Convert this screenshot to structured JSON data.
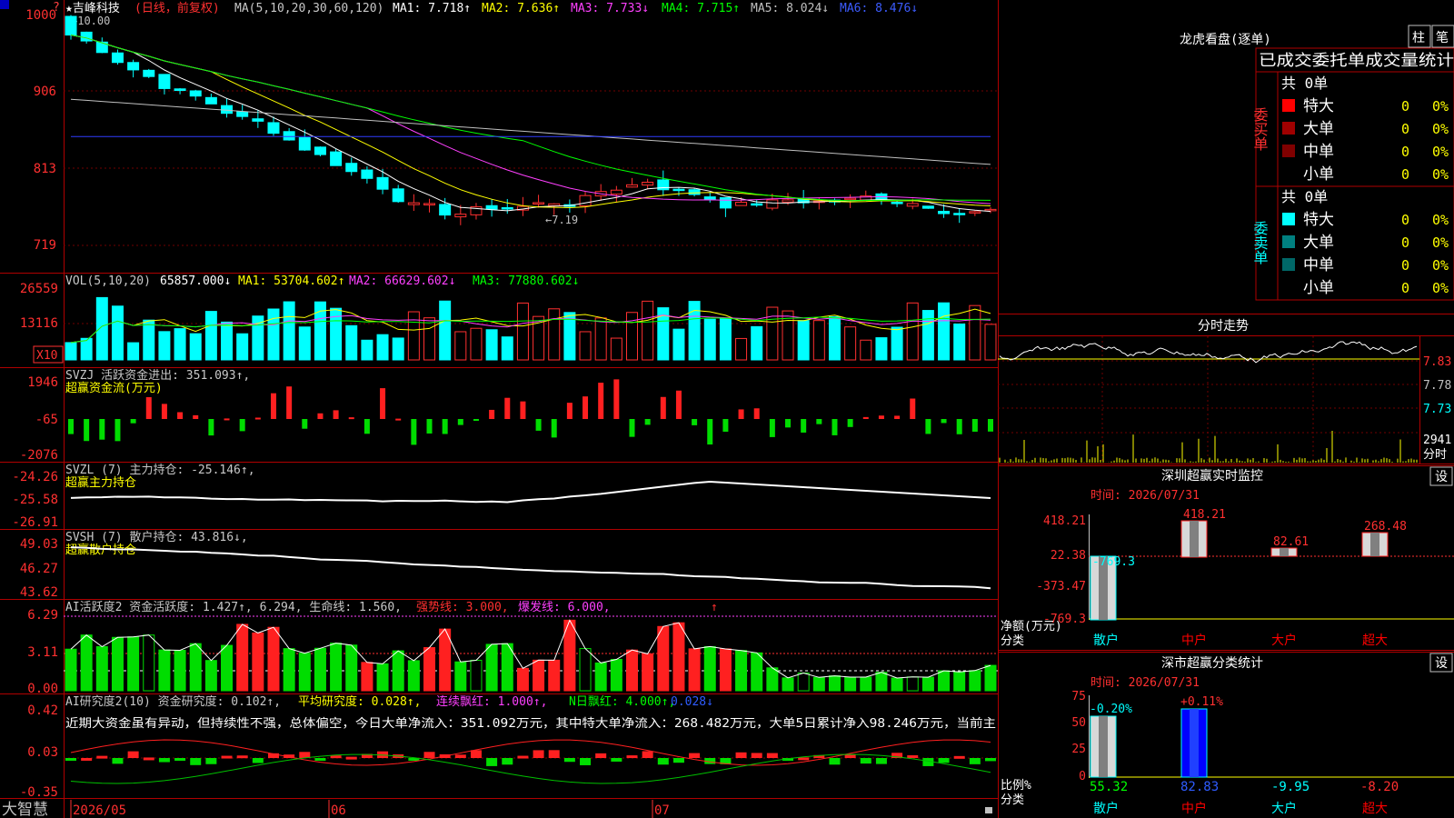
{
  "header": {
    "stock_label": "★吉峰科技",
    "period_label": "(日线，前复权)",
    "ma_label": "MA(5,10,20,30,60,120)",
    "ma_values": [
      {
        "text": "MA1: 7.718↑",
        "color": "#ffffff"
      },
      {
        "text": "MA2: 7.636↑",
        "color": "#ffff00"
      },
      {
        "text": "MA3: 7.733↓",
        "color": "#ff40ff"
      },
      {
        "text": "MA4: 7.715↑",
        "color": "#00ff00"
      },
      {
        "text": "MA5: 8.024↓",
        "color": "#c0c0c0"
      },
      {
        "text": "MA6: 8.476↓",
        "color": "#2f3cff"
      }
    ],
    "corner_mark": "?"
  },
  "price_panel": {
    "y_ticks": [
      "1000",
      "906",
      "813",
      "719"
    ],
    "high_label": "10.00",
    "low_label": "7.19"
  },
  "volume_panel": {
    "label": "VOL(5,10,20)",
    "value": "65857.000↓",
    "ma_values": [
      {
        "text": "MA1: 53704.602↑",
        "color": "#ffff00"
      },
      {
        "text": "MA2: 66629.602↓",
        "color": "#ff40ff"
      },
      {
        "text": "MA3: 77880.602↓",
        "color": "#00ff00"
      }
    ],
    "y_ticks": [
      "26559",
      "13116"
    ],
    "unit_box": "X10"
  },
  "svzj_panel": {
    "label": "SVZJ  活跃资金进出: 351.093↑,",
    "sublabel": "超赢资金流(万元)",
    "y_ticks": [
      "1946",
      "-65",
      "-2076"
    ]
  },
  "svzl_panel": {
    "label": "SVZL (7) 主力持仓: -25.146↑,",
    "sublabel": "超赢主力持仓",
    "y_ticks": [
      "-24.26",
      "-25.58",
      "-26.91"
    ]
  },
  "svsh_panel": {
    "label": "SVSH (7) 散户持仓: 43.816↓,",
    "sublabel": "超赢散户持仓",
    "y_ticks": [
      "49.03",
      "46.27",
      "43.62"
    ]
  },
  "ai_activity_panel": {
    "label": "AI活跃度2 资金活跃度: 1.427↑, 6.294, 生命线: 1.560,",
    "strong_line": "强势线: 3.000,",
    "burst_line": "爆发线: 6.000,",
    "y_ticks": [
      "6.29",
      "3.11",
      "0.00"
    ]
  },
  "ai_research_panel": {
    "label": "AI研究度2(10) 资金研究度: 0.102↑,",
    "avg_label": "平均研究度: 0.028↑,",
    "red_label": "连续飘红: 1.000↑,",
    "nday_label": "N日飘红: 4.000↑,",
    "last_value": "0.028↓",
    "commentary": "近期大资金虽有异动，但持续性不强，总体偏空，今日大单净流入：351.092万元，其中特大单净流入：268.482万元，大单5日累计净入98.246万元，当前主",
    "y_ticks": [
      "0.42",
      "0.03",
      "-0.35"
    ]
  },
  "bottom_axis": {
    "brand": "大智慧",
    "dates": [
      "2026/05",
      "06",
      "07"
    ]
  },
  "dragon_tiger": {
    "title": "龙虎看盘(逐单)",
    "btn_zhu": "柱",
    "btn_bi": "笔",
    "tabs_text": "已成交委托单成交量统计",
    "buy_label": "委买单",
    "sell_label": "委卖单",
    "buy_total": "共 0单",
    "sell_total": "共 0单",
    "buy_rows": [
      {
        "name": "特大",
        "count": "0",
        "pct": "0%",
        "color": "#ff0000"
      },
      {
        "name": "大单",
        "count": "0",
        "pct": "0%",
        "color": "#a00000"
      },
      {
        "name": "中单",
        "count": "0",
        "pct": "0%",
        "color": "#800000"
      },
      {
        "name": "小单",
        "count": "0",
        "pct": "0%",
        "color": "#000000"
      }
    ],
    "sell_rows": [
      {
        "name": "特大",
        "count": "0",
        "pct": "0%",
        "color": "#00ffff"
      },
      {
        "name": "大单",
        "count": "0",
        "pct": "0%",
        "color": "#008080"
      },
      {
        "name": "中单",
        "count": "0",
        "pct": "0%",
        "color": "#006868"
      },
      {
        "name": "小单",
        "count": "0",
        "pct": "0%",
        "color": "#000000"
      }
    ]
  },
  "intraday": {
    "title": "分时走势",
    "price_ticks": [
      "7.83",
      "7.78",
      "7.73"
    ],
    "vol_tick": "2941",
    "vol_unit": "分时"
  },
  "sz_monitor": {
    "title": "深圳超赢实时监控",
    "set_btn": "设",
    "time_label": "时间: 2026/07/31",
    "y_ticks": [
      "418.21",
      "22.38",
      "-373.47",
      "-769.3"
    ],
    "bar_labels": [
      "-769.3",
      "418.21",
      "82.61",
      "268.48"
    ],
    "axis_label_1": "净额(万元)",
    "axis_label_2": "分类",
    "categories": [
      "散户",
      "中户",
      "大户",
      "超大"
    ],
    "category_colors": [
      "#00ffff",
      "#ff0000",
      "#ff0000",
      "#ff0000"
    ]
  },
  "sz_classify": {
    "title": "深市超赢分类统计",
    "set_btn": "设",
    "time_label": "时间: 2026/07/31",
    "y_ticks": [
      "75",
      "50",
      "25",
      "0"
    ],
    "bar_labels": [
      "-0.20%",
      "+0.11%"
    ],
    "values": [
      "55.32",
      "82.83",
      "-9.95",
      "-8.20"
    ],
    "axis_label_1": "比例%",
    "axis_label_2": "分类",
    "categories": [
      "散户",
      "中户",
      "大户",
      "超大"
    ],
    "category_colors": [
      "#00ffff",
      "#ff0000",
      "#00ffff",
      "#ff0000"
    ]
  },
  "chart_data": {
    "type": "candlestick",
    "x": [
      "2026/05",
      "06",
      "07"
    ],
    "ylim": [
      7.19,
      10.0
    ],
    "series": [
      {
        "name": "MA1",
        "values": [
          7.718
        ]
      },
      {
        "name": "MA2",
        "values": [
          7.636
        ]
      },
      {
        "name": "MA3",
        "values": [
          7.733
        ]
      },
      {
        "name": "MA4",
        "values": [
          7.715
        ]
      },
      {
        "name": "MA5",
        "values": [
          8.024
        ]
      },
      {
        "name": "MA6",
        "values": [
          8.476
        ]
      }
    ]
  }
}
